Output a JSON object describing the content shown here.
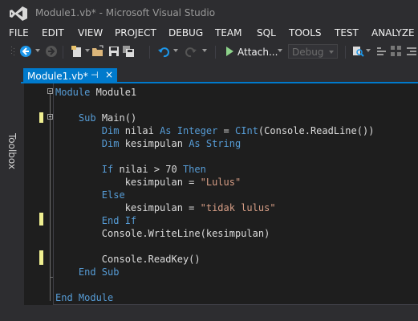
{
  "window": {
    "title": "Module1.vb* - Microsoft Visual Studio"
  },
  "menu": [
    "FILE",
    "EDIT",
    "VIEW",
    "PROJECT",
    "DEBUG",
    "TEAM",
    "SQL",
    "TOOLS",
    "TEST",
    "ANALYZE"
  ],
  "toolbar": {
    "attach_label": "Attach...",
    "config_value": "Debug"
  },
  "toolbox": {
    "label": "Toolbox"
  },
  "tab": {
    "label": "Module1.vb*",
    "pin_glyph": "⊣",
    "close_glyph": "×"
  },
  "code": {
    "lines": [
      [
        [
          "kw",
          "Module"
        ],
        [
          "txt",
          " Module1"
        ]
      ],
      [],
      [
        [
          "txt",
          "    "
        ],
        [
          "kw",
          "Sub"
        ],
        [
          "txt",
          " Main()"
        ]
      ],
      [
        [
          "txt",
          "        "
        ],
        [
          "kw",
          "Dim"
        ],
        [
          "txt",
          " nilai "
        ],
        [
          "kw",
          "As"
        ],
        [
          "txt",
          " "
        ],
        [
          "kw",
          "Integer"
        ],
        [
          "txt",
          " = "
        ],
        [
          "kw",
          "CInt"
        ],
        [
          "txt",
          "(Console.ReadLine())"
        ]
      ],
      [
        [
          "txt",
          "        "
        ],
        [
          "kw",
          "Dim"
        ],
        [
          "txt",
          " kesimpulan "
        ],
        [
          "kw",
          "As"
        ],
        [
          "txt",
          " "
        ],
        [
          "kw",
          "String"
        ]
      ],
      [],
      [
        [
          "txt",
          "        "
        ],
        [
          "kw",
          "If"
        ],
        [
          "txt",
          " nilai > 70 "
        ],
        [
          "kw",
          "Then"
        ]
      ],
      [
        [
          "txt",
          "            kesimpulan = "
        ],
        [
          "str",
          "\"Lulus\""
        ]
      ],
      [
        [
          "txt",
          "        "
        ],
        [
          "kw",
          "Else"
        ]
      ],
      [
        [
          "txt",
          "            kesimpulan = "
        ],
        [
          "str",
          "\"tidak lulus\""
        ]
      ],
      [
        [
          "txt",
          "        "
        ],
        [
          "kw",
          "End If"
        ]
      ],
      [
        [
          "txt",
          "        Console.WriteLine(kesimpulan)"
        ]
      ],
      [],
      [
        [
          "txt",
          "        Console.ReadKey()"
        ]
      ],
      [
        [
          "txt",
          "    "
        ],
        [
          "kw",
          "End Sub"
        ]
      ],
      [],
      [
        [
          "kw",
          "End Module"
        ]
      ]
    ]
  },
  "colors": {
    "accent": "#007acc",
    "keyword": "#569cd6",
    "string": "#d69d85",
    "change_marker": "#efef91"
  }
}
